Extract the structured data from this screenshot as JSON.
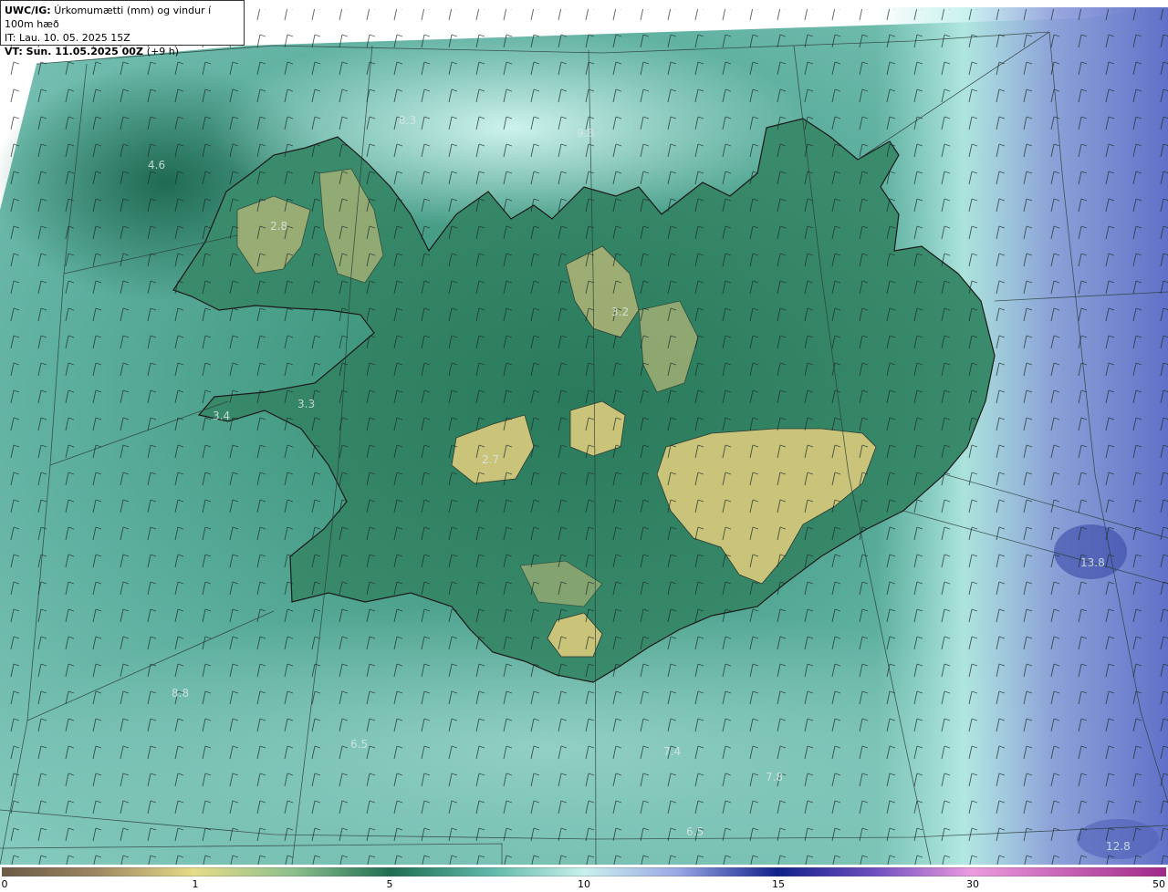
{
  "info": {
    "model_code": "UWC/IG:",
    "title": "Úrkomumætti (mm) og vindur í 100m hæð",
    "issue_time": "IT: Lau. 10. 05. 2025 15Z",
    "valid_time": "VT: Sun. 11.05.2025 00Z",
    "lead_time": "(+9 h)"
  },
  "colorbar": {
    "labels": [
      "0",
      "1",
      "5",
      "10",
      "15",
      "30",
      "50"
    ],
    "colors": [
      "#6b5a45",
      "#b9a06a",
      "#e8e08a",
      "#6fae7e",
      "#2f7a5f",
      "#6ec3b6",
      "#c8f0ec",
      "#7f8fd6",
      "#20308f",
      "#b050c0",
      "#e890d8",
      "#a03090"
    ]
  },
  "point_labels": [
    {
      "text": "4.6"
    },
    {
      "text": "8.3"
    },
    {
      "text": "9.8"
    },
    {
      "text": "2.8"
    },
    {
      "text": "3.2"
    },
    {
      "text": "3.3"
    },
    {
      "text": "3.4"
    },
    {
      "text": "2.7"
    },
    {
      "text": "13.8"
    },
    {
      "text": "8.8"
    },
    {
      "text": "6.5"
    },
    {
      "text": "7.4"
    },
    {
      "text": "7.8"
    },
    {
      "text": "6.5"
    },
    {
      "text": "12.8"
    }
  ]
}
